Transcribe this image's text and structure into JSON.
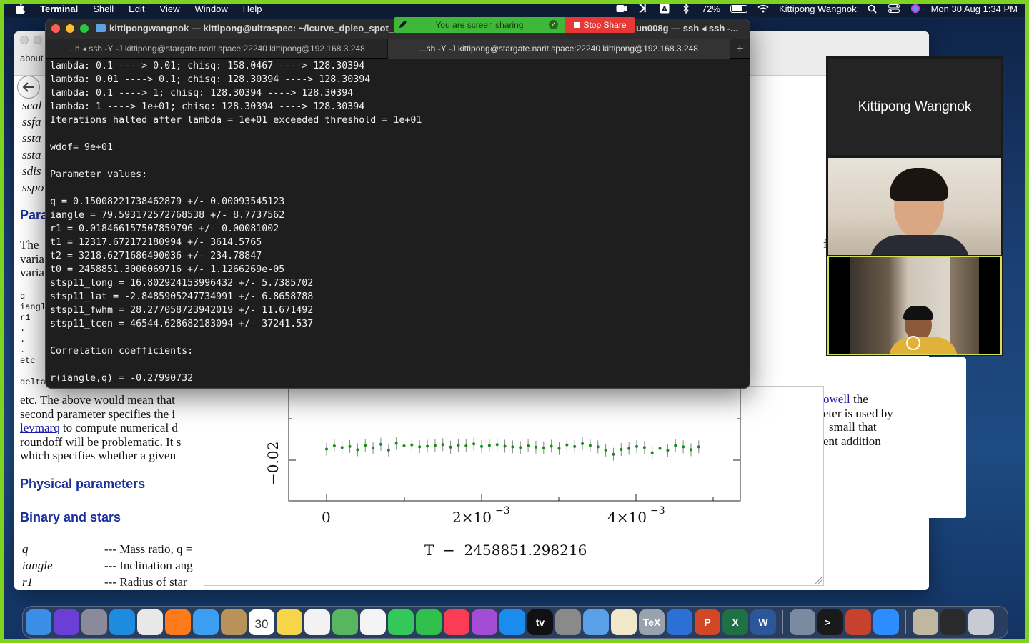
{
  "menubar": {
    "app_name": "Terminal",
    "items": [
      "Shell",
      "Edit",
      "View",
      "Window",
      "Help"
    ],
    "battery": "72%",
    "user": "Kittipong Wangnok",
    "datetime": "Mon 30 Aug  1:34 PM"
  },
  "share_banner": {
    "message": "You are screen sharing",
    "stop_label": "Stop Share"
  },
  "terminal": {
    "title": "kittipongwangnok — kittipong@ultraspec: ~/lcurve_dpleo_spot_",
    "title_right": "un008g — ssh ◂ ssh -...",
    "tabs": [
      "...h ◂ ssh -Y -J kittipong@stargate.narit.space:22240 kittipong@192.168.3.248",
      "...sh -Y -J kittipong@stargate.narit.space:22240 kittipong@192.168.3.248"
    ],
    "add_tab": "+",
    "lines": [
      "lambda: 0.1 ----> 0.01; chisq: 158.0467 ----> 128.30394",
      "lambda: 0.01 ----> 0.1; chisq: 128.30394 ----> 128.30394",
      "lambda: 0.1 ----> 1; chisq: 128.30394 ----> 128.30394",
      "lambda: 1 ----> 1e+01; chisq: 128.30394 ----> 128.30394",
      "Iterations halted after lambda = 1e+01 exceeded threshold = 1e+01",
      "",
      "wdof= 9e+01",
      "",
      "Parameter values:",
      "",
      "q = 0.15008221738462879 +/- 0.00093545123",
      "iangle = 79.593172572768538 +/- 8.7737562",
      "r1 = 0.018466157507859796 +/- 0.00081002",
      "t1 = 12317.672172180994 +/- 3614.5765",
      "t2 = 3218.6271686490036 +/- 234.78847",
      "t0 = 2458851.3006069716 +/- 1.1266269e-05",
      "stsp11_long = 16.802924153996432 +/- 5.7385702",
      "stsp11_lat = -2.8485905247734991 +/- 6.8658788",
      "stsp11_fwhm = 28.277058723942019 +/- 11.671492",
      "stsp11_tcen = 46544.628682183094 +/- 37241.537",
      "",
      "Correlation coefficients:",
      "",
      "r(iangle,q) = -0.27990732"
    ]
  },
  "browser": {
    "tab_label": "about",
    "code_lines": [
      "scal",
      "ssfa",
      "ssta",
      "ssta",
      "sdis",
      "sspo"
    ],
    "heading_params": "Para",
    "para_intro": [
      "The",
      "varia",
      "varia"
    ],
    "mono_list": [
      "q",
      "iangl",
      "r1",
      ".",
      ".",
      ".",
      "etc",
      "",
      "delta"
    ],
    "body_lines": [
      "etc. The above would mean that",
      "second parameter specifies the i",
      "to compute numerical d",
      "roundoff will be problematic. It s",
      "which specifies whether a given"
    ],
    "link_levmarq": "levmarq",
    "right_fragments": [
      "owell",
      "the",
      "eter is used by",
      "small that",
      "ent addition"
    ],
    "heading_physical": "Physical parameters",
    "heading_binary": "Binary and stars",
    "param_rows": [
      {
        "name": "q",
        "desc": "--- Mass ratio, q ="
      },
      {
        "name": "iangle",
        "desc": "--- Inclination ang"
      },
      {
        "name": "r1",
        "desc": "--- Radius of star"
      }
    ],
    "right_edge_letter": "f"
  },
  "plot": {
    "x_ticks": [
      "0",
      "2×10",
      "4×10"
    ],
    "x_exponent": "−3",
    "y_tick": "−0.02",
    "xlabel": "T  −  2458851.298216"
  },
  "chart_data": {
    "type": "scatter",
    "xlabel": "T  −  2458851.298216",
    "x_unit_note": "",
    "xlim": [
      -0.0006,
      0.0054
    ],
    "ylim": [
      -0.028,
      -0.016
    ],
    "series": [
      {
        "color": "#1a8a1a",
        "x": [
          0.0,
          0.0001,
          0.0002,
          0.0003,
          0.0004,
          0.0005,
          0.0006,
          0.0007,
          0.0008,
          0.0009,
          0.001,
          0.0011,
          0.0012,
          0.0013,
          0.0014,
          0.0015,
          0.0016,
          0.0017,
          0.0018,
          0.0019,
          0.002,
          0.0021,
          0.0022,
          0.0023,
          0.0024,
          0.0025,
          0.0026,
          0.0027,
          0.0028,
          0.0029,
          0.003,
          0.0031,
          0.0032,
          0.0033,
          0.0034,
          0.0035,
          0.0036,
          0.0037,
          0.0038,
          0.0039,
          0.004,
          0.0041,
          0.0042,
          0.0043,
          0.0044,
          0.0045,
          0.0046,
          0.0047,
          0.0048
        ],
        "y": [
          -0.021,
          -0.02,
          -0.0205,
          -0.0202,
          -0.0212,
          -0.0198,
          -0.0207,
          -0.0195,
          -0.0213,
          -0.0192,
          -0.02,
          -0.0197,
          -0.0203,
          -0.0201,
          -0.0199,
          -0.0196,
          -0.0204,
          -0.0198,
          -0.02,
          -0.0194,
          -0.0202,
          -0.0199,
          -0.0196,
          -0.0201,
          -0.0203,
          -0.0205,
          -0.02,
          -0.0204,
          -0.0206,
          -0.0201,
          -0.0208,
          -0.0197,
          -0.0202,
          -0.0193,
          -0.0199,
          -0.0203,
          -0.0213,
          -0.0226,
          -0.0211,
          -0.0208,
          -0.0202,
          -0.0205,
          -0.0221,
          -0.0208,
          -0.0214,
          -0.0199,
          -0.0203,
          -0.0212,
          -0.0203
        ]
      }
    ]
  },
  "zoom": {
    "name_tile": "Kittipong Wangnok"
  },
  "dock": {
    "apps": [
      {
        "name": "finder-icon",
        "label": "",
        "color": "#3a8ee6"
      },
      {
        "name": "siri-icon",
        "label": "",
        "color": "#6b3fd6"
      },
      {
        "name": "launchpad-icon",
        "label": "",
        "color": "#8a8a9a"
      },
      {
        "name": "safari-icon",
        "label": "",
        "color": "#1d8ce0"
      },
      {
        "name": "chrome-icon",
        "label": "",
        "color": "#e8e8e8"
      },
      {
        "name": "firefox-icon",
        "label": "",
        "color": "#ff7a1a"
      },
      {
        "name": "mail-icon",
        "label": "",
        "color": "#3c9ef0"
      },
      {
        "name": "contacts-icon",
        "label": "",
        "color": "#b8925a"
      },
      {
        "name": "calendar-icon",
        "label": "30",
        "color": "#ffffff"
      },
      {
        "name": "notes-icon",
        "label": "",
        "color": "#f7d54b"
      },
      {
        "name": "reminders-icon",
        "label": "",
        "color": "#f2f2f2"
      },
      {
        "name": "maps-icon",
        "label": "",
        "color": "#58b560"
      },
      {
        "name": "photos-icon",
        "label": "",
        "color": "#f4f4f4"
      },
      {
        "name": "messages-icon",
        "label": "",
        "color": "#34c759"
      },
      {
        "name": "facetime-icon",
        "label": "",
        "color": "#2fbf4a"
      },
      {
        "name": "music-icon",
        "label": "",
        "color": "#fa3c55"
      },
      {
        "name": "podcasts-icon",
        "label": "",
        "color": "#a54cd6"
      },
      {
        "name": "appstore-icon",
        "label": "",
        "color": "#1a8cf0"
      },
      {
        "name": "appletv-icon",
        "label": "tv",
        "color": "#111111"
      },
      {
        "name": "system-preferences-icon",
        "label": "",
        "color": "#8a8a8a"
      },
      {
        "name": "preview-icon",
        "label": "",
        "color": "#5aa0e6"
      },
      {
        "name": "texteditor-icon",
        "label": "",
        "color": "#f2e7c8"
      },
      {
        "name": "tex-icon",
        "label": "TeX",
        "color": "#9aa3ad"
      },
      {
        "name": "xcode-icon",
        "label": "",
        "color": "#2c6fd6"
      },
      {
        "name": "powerpoint-icon",
        "label": "P",
        "color": "#d24726"
      },
      {
        "name": "excel-icon",
        "label": "X",
        "color": "#1e7145"
      },
      {
        "name": "word-icon",
        "label": "W",
        "color": "#2b579a"
      }
    ],
    "apps_right": [
      {
        "name": "screenshot-icon",
        "label": "",
        "color": "#7a8aa0"
      },
      {
        "name": "terminal-icon",
        "label": ">_",
        "color": "#1a1a1a"
      },
      {
        "name": "x11-icon",
        "label": "",
        "color": "#c8412f"
      },
      {
        "name": "zoom-icon",
        "label": "",
        "color": "#2d8cff"
      }
    ],
    "apps_far": [
      {
        "name": "document-thumbnail-icon",
        "label": "",
        "color": "#bfb7a0"
      },
      {
        "name": "minimized-window-icon",
        "label": "",
        "color": "#2a2a2a"
      },
      {
        "name": "trash-icon",
        "label": "",
        "color": "#c8ccd2"
      }
    ]
  }
}
